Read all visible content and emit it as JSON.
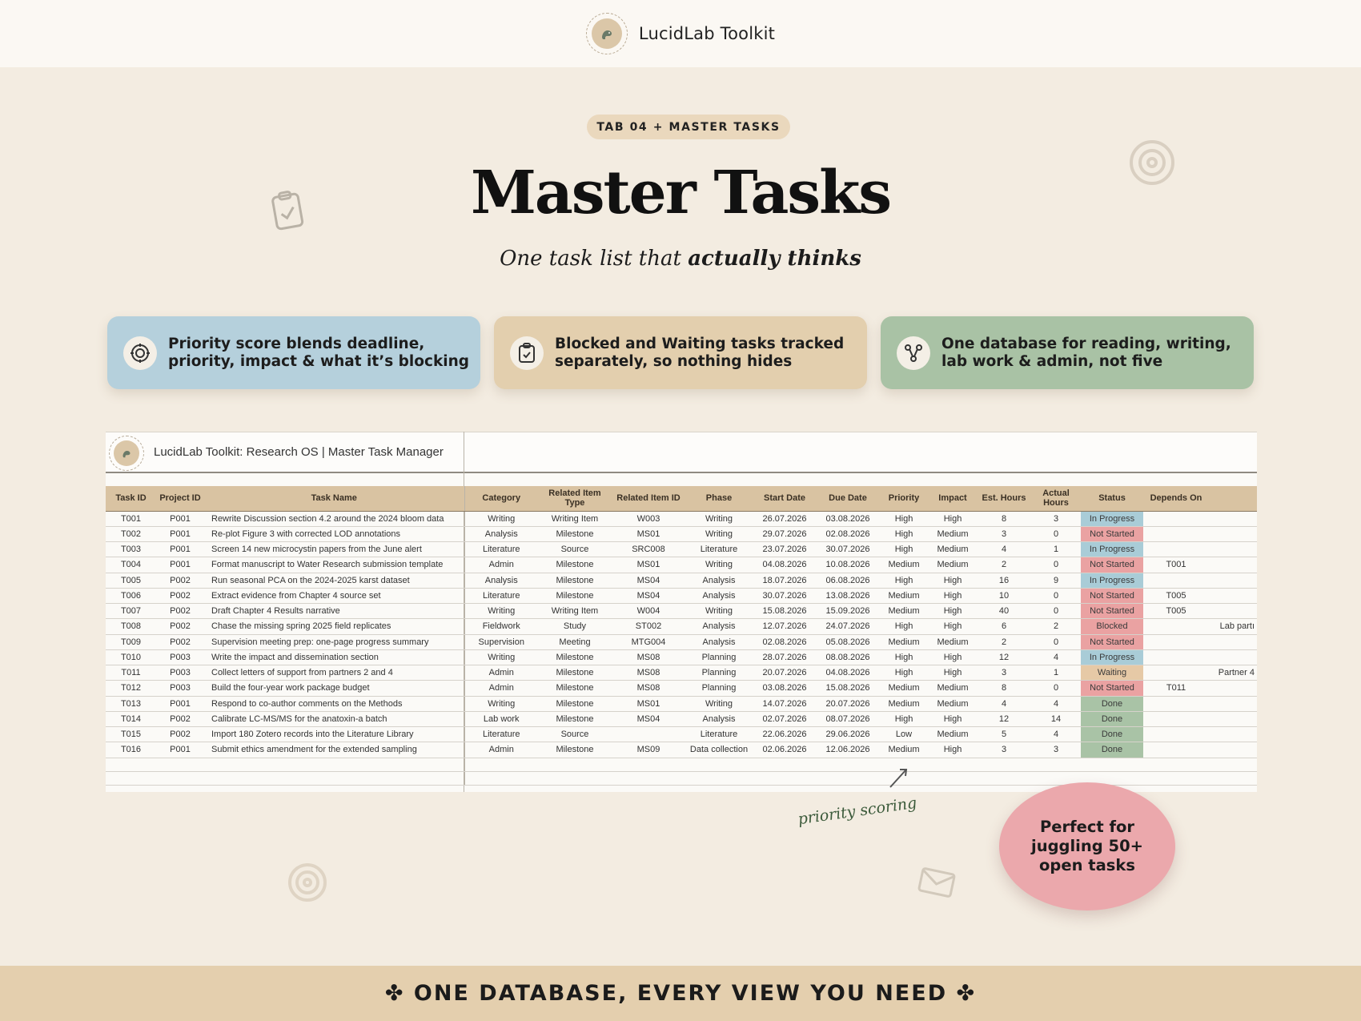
{
  "brand": {
    "name": "LucidLab Toolkit"
  },
  "hero": {
    "pill": "TAB 04 + MASTER TASKS",
    "title": "Master Tasks",
    "subtitle_plain": "One task list that ",
    "subtitle_bold": "actually thinks"
  },
  "features": [
    {
      "icon": "target-icon",
      "color": "#b5d0dc",
      "line1": "Priority score blends deadline,",
      "line2": "priority, impact & what it’s blocking"
    },
    {
      "icon": "clipboard-check-icon",
      "color": "#e3cfae",
      "line1": "Blocked and Waiting tasks tracked",
      "line2": "separately, so nothing hides"
    },
    {
      "icon": "network-icon",
      "color": "#a9c2a5",
      "line1": "One database for reading, writing,",
      "line2": "lab work & admin, not five"
    }
  ],
  "sheet": {
    "title": "LucidLab Toolkit: Research OS  |  Master Task Manager",
    "columns": [
      "Task ID",
      "Project ID",
      "Task Name",
      "Category",
      "Related Item Type",
      "Related Item ID",
      "Phase",
      "Start Date",
      "Due Date",
      "Priority",
      "Impact",
      "Est. Hours",
      "Actual Hours",
      "Status",
      "Depends On",
      ""
    ],
    "rows": [
      [
        "T001",
        "P001",
        "Rewrite Discussion section 4.2 around the 2024 bloom data",
        "Writing",
        "Writing Item",
        "W003",
        "Writing",
        "26.07.2026",
        "03.08.2026",
        "High",
        "High",
        "8",
        "3",
        "In Progress",
        "",
        ""
      ],
      [
        "T002",
        "P001",
        "Re-plot Figure 3 with corrected LOD annotations",
        "Analysis",
        "Milestone",
        "MS01",
        "Writing",
        "29.07.2026",
        "02.08.2026",
        "High",
        "Medium",
        "3",
        "0",
        "Not Started",
        "",
        ""
      ],
      [
        "T003",
        "P001",
        "Screen 14 new microcystin papers from the June alert",
        "Literature",
        "Source",
        "SRC008",
        "Literature",
        "23.07.2026",
        "30.07.2026",
        "High",
        "Medium",
        "4",
        "1",
        "In Progress",
        "",
        ""
      ],
      [
        "T004",
        "P001",
        "Format manuscript to Water Research submission template",
        "Admin",
        "Milestone",
        "MS01",
        "Writing",
        "04.08.2026",
        "10.08.2026",
        "Medium",
        "Medium",
        "2",
        "0",
        "Not Started",
        "T001",
        ""
      ],
      [
        "T005",
        "P002",
        "Run seasonal PCA on the 2024-2025 karst dataset",
        "Analysis",
        "Milestone",
        "MS04",
        "Analysis",
        "18.07.2026",
        "06.08.2026",
        "High",
        "High",
        "16",
        "9",
        "In Progress",
        "",
        ""
      ],
      [
        "T006",
        "P002",
        "Extract evidence from Chapter 4 source set",
        "Literature",
        "Milestone",
        "MS04",
        "Analysis",
        "30.07.2026",
        "13.08.2026",
        "Medium",
        "High",
        "10",
        "0",
        "Not Started",
        "T005",
        ""
      ],
      [
        "T007",
        "P002",
        "Draft Chapter 4 Results narrative",
        "Writing",
        "Writing Item",
        "W004",
        "Writing",
        "15.08.2026",
        "15.09.2026",
        "Medium",
        "High",
        "40",
        "0",
        "Not Started",
        "T005",
        ""
      ],
      [
        "T008",
        "P002",
        "Chase the missing spring 2025 field replicates",
        "Fieldwork",
        "Study",
        "ST002",
        "Analysis",
        "12.07.2026",
        "24.07.2026",
        "High",
        "High",
        "6",
        "2",
        "Blocked",
        "",
        "Lab partı"
      ],
      [
        "T009",
        "P002",
        "Supervision meeting prep: one-page progress summary",
        "Supervision",
        "Meeting",
        "MTG004",
        "Analysis",
        "02.08.2026",
        "05.08.2026",
        "Medium",
        "Medium",
        "2",
        "0",
        "Not Started",
        "",
        ""
      ],
      [
        "T010",
        "P003",
        "Write the impact and dissemination section",
        "Writing",
        "Milestone",
        "MS08",
        "Planning",
        "28.07.2026",
        "08.08.2026",
        "High",
        "High",
        "12",
        "4",
        "In Progress",
        "",
        ""
      ],
      [
        "T011",
        "P003",
        "Collect letters of support from partners 2 and 4",
        "Admin",
        "Milestone",
        "MS08",
        "Planning",
        "20.07.2026",
        "04.08.2026",
        "High",
        "High",
        "3",
        "1",
        "Waiting",
        "",
        "Partner 4"
      ],
      [
        "T012",
        "P003",
        "Build the four-year work package budget",
        "Admin",
        "Milestone",
        "MS08",
        "Planning",
        "03.08.2026",
        "15.08.2026",
        "Medium",
        "Medium",
        "8",
        "0",
        "Not Started",
        "T011",
        ""
      ],
      [
        "T013",
        "P001",
        "Respond to co-author comments on the Methods",
        "Writing",
        "Milestone",
        "MS01",
        "Writing",
        "14.07.2026",
        "20.07.2026",
        "Medium",
        "Medium",
        "4",
        "4",
        "Done",
        "",
        ""
      ],
      [
        "T014",
        "P002",
        "Calibrate LC-MS/MS for the anatoxin-a batch",
        "Lab work",
        "Milestone",
        "MS04",
        "Analysis",
        "02.07.2026",
        "08.07.2026",
        "High",
        "High",
        "12",
        "14",
        "Done",
        "",
        ""
      ],
      [
        "T015",
        "P002",
        "Import 180 Zotero records into the Literature Library",
        "Literature",
        "Source",
        "",
        "Literature",
        "22.06.2026",
        "29.06.2026",
        "Low",
        "Medium",
        "5",
        "4",
        "Done",
        "",
        ""
      ],
      [
        "T016",
        "P001",
        "Submit ethics amendment for the extended sampling",
        "Admin",
        "Milestone",
        "MS09",
        "Data collection",
        "02.06.2026",
        "12.06.2026",
        "Medium",
        "High",
        "3",
        "3",
        "Done",
        "",
        ""
      ]
    ]
  },
  "annotation": "priority scoring",
  "badge": {
    "line1": "Perfect for",
    "line2": "juggling 50+",
    "line3": "open tasks"
  },
  "footer": "✤ ONE DATABASE, EVERY VIEW YOU NEED ✤",
  "colors": {
    "in_progress": "#a9ccd7",
    "not_started": "#eaa2a2",
    "blocked": "#eaa2a2",
    "waiting": "#e6c9a6",
    "done": "#a9c3a6"
  }
}
